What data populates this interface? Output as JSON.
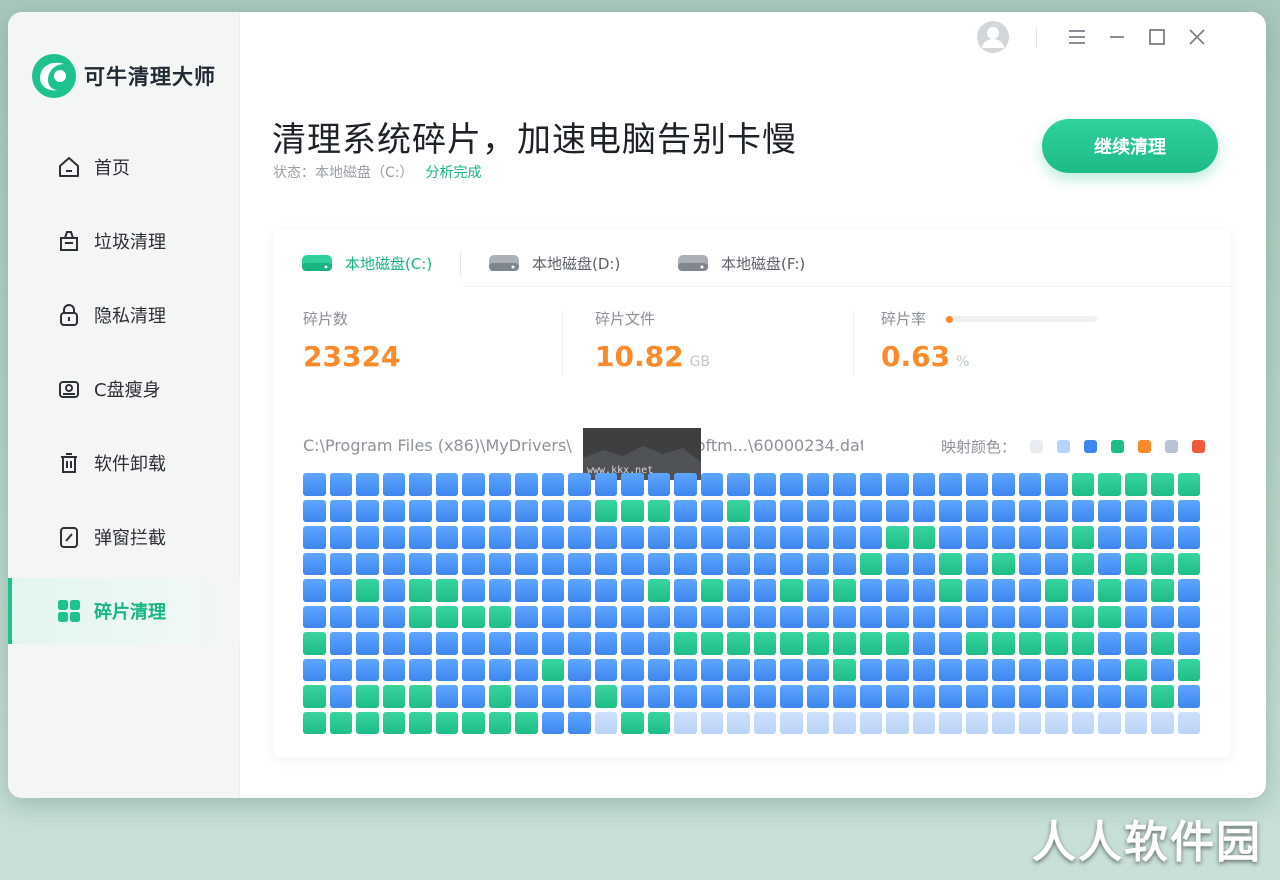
{
  "app": {
    "name": "可牛清理大师",
    "brand_color": "#1ec28f"
  },
  "sidebar": {
    "items": [
      {
        "label": "首页",
        "icon": "home-icon"
      },
      {
        "label": "垃圾清理",
        "icon": "trash-bag-icon"
      },
      {
        "label": "隐私清理",
        "icon": "lock-icon"
      },
      {
        "label": "C盘瘦身",
        "icon": "disk-icon"
      },
      {
        "label": "软件卸载",
        "icon": "uninstall-icon"
      },
      {
        "label": "弹窗拦截",
        "icon": "popup-block-icon"
      },
      {
        "label": "碎片清理",
        "icon": "grid-icon",
        "active": true
      }
    ]
  },
  "topbar": {
    "icons": [
      "avatar-icon",
      "menu-icon",
      "minimize-icon",
      "maximize-icon",
      "close-icon"
    ]
  },
  "header": {
    "title": "清理系统碎片，加速电脑告别卡慢",
    "status_prefix": "状态：本地磁盘（C:）",
    "status_done": "分析完成",
    "action_label": "继续清理"
  },
  "tabs": [
    {
      "label": "本地磁盘(C:)",
      "active": true
    },
    {
      "label": "本地磁盘(D:)",
      "active": false
    },
    {
      "label": "本地磁盘(F:)",
      "active": false
    }
  ],
  "stats": {
    "fragments": {
      "label": "碎片数",
      "value": "23324"
    },
    "files": {
      "label": "碎片文件",
      "value": "10.82",
      "unit": "GB"
    },
    "rate": {
      "label": "碎片率",
      "value": "0.63",
      "unit": "%",
      "fraction": 0.0063
    }
  },
  "scan": {
    "path": "C:\\Program Files (x86)\\MyDrivers\\",
    "path_tail": "oftm...\\60000234.dat",
    "legend_label": "映射颜色：",
    "legend_colors": [
      "#e9edf1",
      "#b9d2f7",
      "#3e86ee",
      "#1fbd86",
      "#fb8a2b",
      "#b9c3d6",
      "#ef5a3c"
    ]
  },
  "map": {
    "rows": [
      "BBBBBBBBBBBBBBBBBBBBBBBBBBBBBGGGGGB",
      "BBBBBBBBBBBGGGBBGBBBBBBBBBBBBBBBBBB",
      "BBBBBBBBBBBBBBBBBBBBBBGGBBBBBGBBBBB",
      "BBBBBBBBBBBBBBBBBBBBBGBBGBGBBGBGGGB",
      "BBGBGGBBBBBBBGBGBBGBGBBBGBBBGBGBGBB",
      "BBBBGGGGBBBBBBBBBBBBBBBBBBBBBGGBBBB",
      "GBBBBBBBBBBBBBGGGGGGGGGBBGGGGGBBGBB",
      "BBBBBBBBBGBBBBBBBBBBGBBBBBBBBBBGBGB",
      "GBGGGBBGBBBGBBBBBBBBBBBBBBBBBBBBGBG",
      "GGGGGGGGGBBLGGLLLLLLLLLLLLLLLLLLLL"
    ]
  },
  "watermark": {
    "site": "人人软件园",
    "small": "www.kkx.net"
  }
}
